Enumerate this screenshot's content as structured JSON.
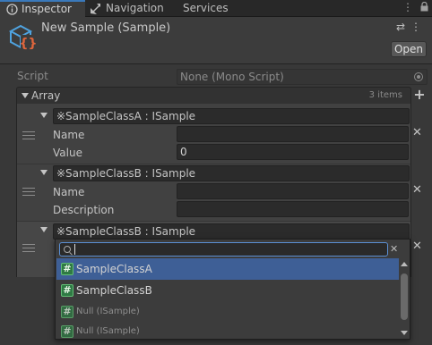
{
  "tabs": [
    {
      "label": "Inspector",
      "icon": "info-icon",
      "active": true
    },
    {
      "label": "Navigation",
      "icon": "navigation-icon",
      "active": false
    },
    {
      "label": "Services",
      "active": false
    }
  ],
  "window_controls": {
    "more": "⋮",
    "lock": "🔒"
  },
  "header": {
    "title": "New Sample (Sample)",
    "asset_icon": "scriptable-object-icon",
    "settings_glyph": "⇄",
    "menu_glyph": "⋮",
    "open_label": "Open"
  },
  "script": {
    "label": "Script",
    "value": "None (Mono Script)"
  },
  "array": {
    "label": "Array",
    "count": "3 items",
    "add_glyph": "+",
    "elements": [
      {
        "type": "※SampleClassA : ISample",
        "fields": [
          {
            "label": "Name",
            "value": ""
          },
          {
            "label": "Value",
            "value": "0"
          }
        ]
      },
      {
        "type": "※SampleClassB : ISample",
        "fields": [
          {
            "label": "Name",
            "value": ""
          },
          {
            "label": "Description",
            "value": ""
          }
        ]
      },
      {
        "type": "※SampleClassB : ISample",
        "fields": []
      }
    ],
    "remove_glyph": "✕"
  },
  "dropdown": {
    "search_value": "",
    "clear_glyph": "✕",
    "items": [
      {
        "label": "SampleClassA",
        "selected": true,
        "dim": false
      },
      {
        "label": "SampleClassB",
        "selected": false,
        "dim": false
      },
      {
        "label": "Null (ISample)",
        "selected": false,
        "dim": true
      },
      {
        "label": "Null (ISample)",
        "selected": false,
        "dim": true
      }
    ],
    "hash_glyph": "#"
  },
  "colors": {
    "accent": "#3a79bb",
    "selection": "#3e5f96",
    "script_icon": "#2f7a44"
  }
}
